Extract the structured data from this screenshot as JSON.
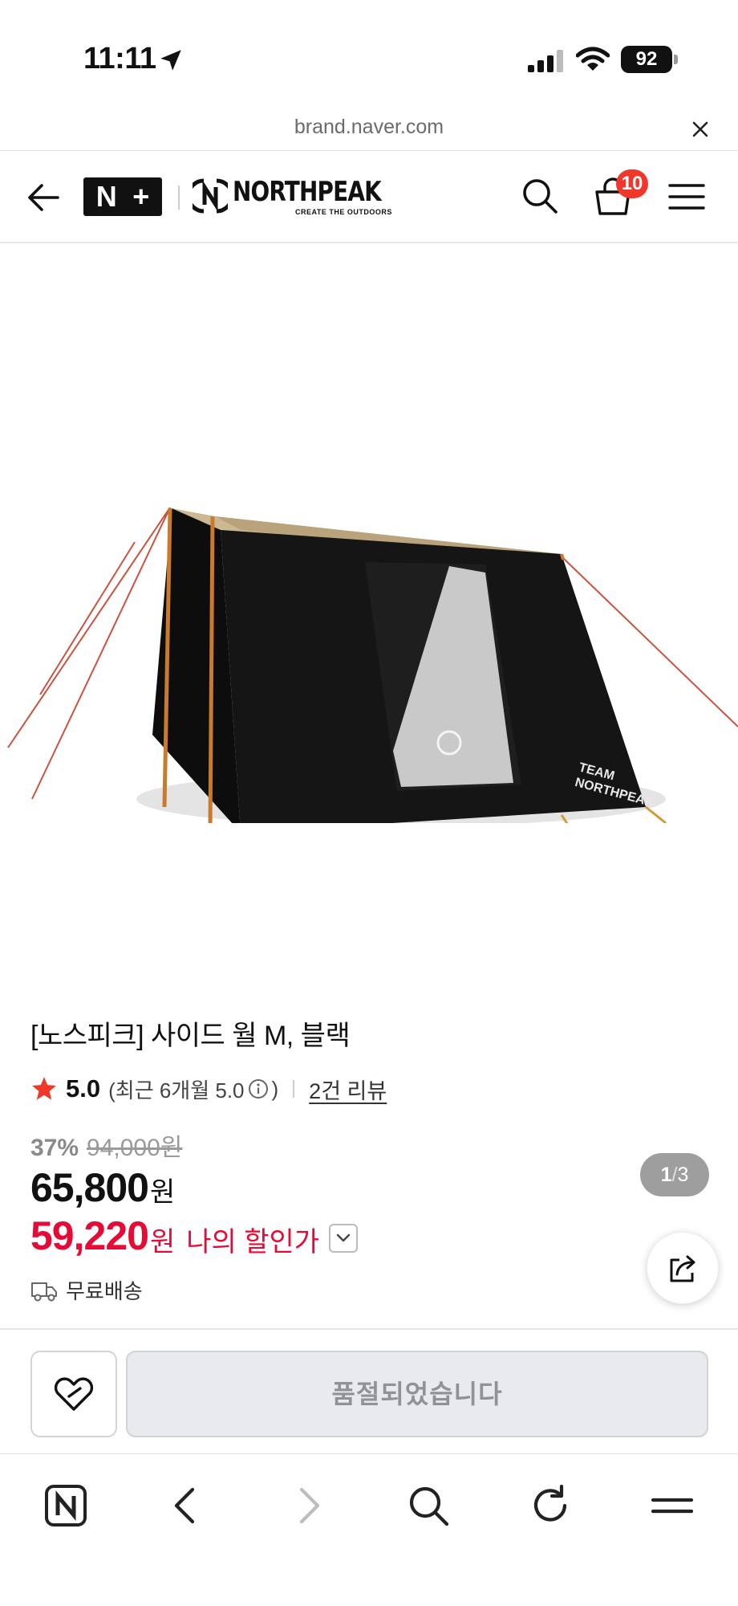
{
  "status_bar": {
    "time": "11:11",
    "battery": "92"
  },
  "browser": {
    "url": "brand.naver.com"
  },
  "header": {
    "nplus_left": "N",
    "nplus_right": "+",
    "brand_name": "NORTHPEAK",
    "brand_tagline": "CREATE THE OUTDOORS",
    "cart_count": "10"
  },
  "gallery": {
    "current": "1",
    "separator": "/",
    "total": "3"
  },
  "product": {
    "title": "[노스피크] 사이드 월 M, 블랙",
    "rating": "5.0",
    "recent_rating_prefix": "(최근 6개월 5.0",
    "recent_rating_suffix": ")",
    "review_link": "2건 리뷰",
    "discount_rate": "37%",
    "original_price": "94,000원",
    "price": "65,800",
    "price_unit": "원",
    "my_price": "59,220",
    "my_price_unit": "원",
    "my_price_label": "나의 할인가",
    "shipping": "무료배송"
  },
  "purchase": {
    "soldout_label": "품절되었습니다"
  },
  "colors": {
    "accent_red": "#e60b37",
    "badge_red": "#f0372a",
    "star": "#f0372a"
  }
}
